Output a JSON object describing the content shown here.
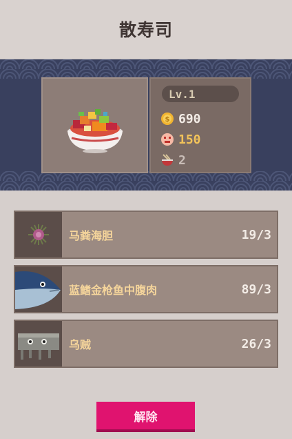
{
  "header": {
    "title": "散寿司"
  },
  "dish": {
    "icon": "chirashi-bowl-icon",
    "level": "Lv.1",
    "coins": "690",
    "fans": "150",
    "bowls": "2"
  },
  "ingredients": [
    {
      "name": "马粪海胆",
      "count": "19/3",
      "icon": "sea-urchin-icon"
    },
    {
      "name": "蓝鳍金枪鱼中腹肉",
      "count": "89/3",
      "icon": "tuna-icon"
    },
    {
      "name": "乌贼",
      "count": "26/3",
      "icon": "squid-icon"
    }
  ],
  "actions": {
    "unlock_label": "解除"
  },
  "colors": {
    "banner": "#39405e",
    "ingredient_name": "#f5d59b",
    "fans_value": "#f2c35a",
    "unlock_button": "#e0136f"
  }
}
